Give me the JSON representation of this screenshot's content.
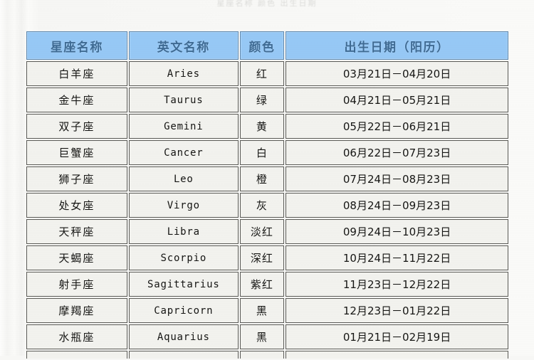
{
  "page": {
    "background_color": "#f7f7f5",
    "top_cropped_artifact": "星座名称   颜色   出生日期"
  },
  "table": {
    "header_background": "#96c8f5",
    "header_text_color": "#3d6a93",
    "cell_background": "#f2f2ee",
    "cell_border_color": "#5a5a56",
    "columns": [
      {
        "key": "name",
        "label": "星座名称"
      },
      {
        "key": "en",
        "label": "英文名称"
      },
      {
        "key": "color",
        "label": "颜色"
      },
      {
        "key": "date",
        "label": "出生日期（阳历）"
      }
    ],
    "rows": [
      {
        "name": "白羊座",
        "en": "Aries",
        "color": "红",
        "date": "03月21日－04月20日"
      },
      {
        "name": "金牛座",
        "en": "Taurus",
        "color": "绿",
        "date": "04月21日－05月21日"
      },
      {
        "name": "双子座",
        "en": "Gemini",
        "color": "黄",
        "date": "05月22日－06月21日"
      },
      {
        "name": "巨蟹座",
        "en": "Cancer",
        "color": "白",
        "date": "06月22日－07月23日"
      },
      {
        "name": "狮子座",
        "en": "Leo",
        "color": "橙",
        "date": "07月24日－08月23日"
      },
      {
        "name": "处女座",
        "en": "Virgo",
        "color": "灰",
        "date": "08月24日－09月23日"
      },
      {
        "name": "天秤座",
        "en": "Libra",
        "color": "淡红",
        "date": "09月24日－10月23日"
      },
      {
        "name": "天蝎座",
        "en": "Scorpio",
        "color": "深红",
        "date": "10月24日－11月22日"
      },
      {
        "name": "射手座",
        "en": "Sagittarius",
        "color": "紫红",
        "date": "11月23日－12月22日"
      },
      {
        "name": "摩羯座",
        "en": "Capricorn",
        "color": "黑",
        "date": "12月23日－01月22日"
      },
      {
        "name": "水瓶座",
        "en": "Aquarius",
        "color": "黑",
        "date": "01月21日－02月19日"
      }
    ],
    "cut_off_row": {
      "name": "",
      "en": "",
      "color": "",
      "date": ""
    }
  }
}
